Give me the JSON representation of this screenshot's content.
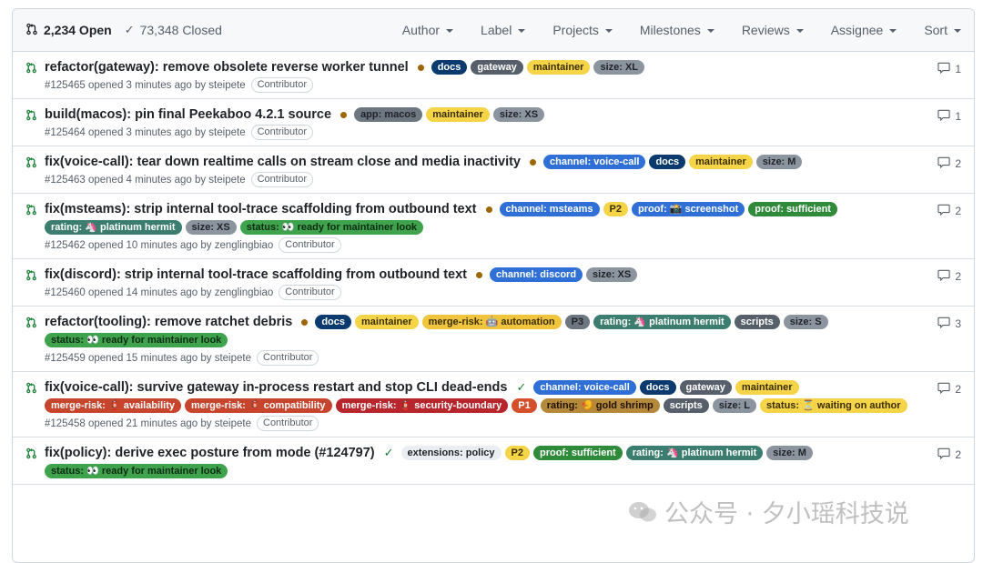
{
  "header": {
    "open_label": "2,234 Open",
    "closed_label": "73,348 Closed",
    "filters": [
      "Author",
      "Label",
      "Projects",
      "Milestones",
      "Reviews",
      "Assignee",
      "Sort"
    ]
  },
  "colors": {
    "open_green": "#1a7f37",
    "pending_dot": "#9a6700"
  },
  "rows": [
    {
      "title": "refactor(gateway): remove obsolete reverse worker tunnel",
      "status": "pending",
      "labels": [
        {
          "text": "docs",
          "bg": "#0b3a6e",
          "fg": "#ffffff"
        },
        {
          "text": "gateway",
          "bg": "#57606a",
          "fg": "#ffffff"
        },
        {
          "text": "maintainer",
          "bg": "#f5d547",
          "fg": "#3a2d00"
        },
        {
          "text": "size: XL",
          "bg": "#8c959f",
          "fg": "#1f2328"
        }
      ],
      "meta": "#125465 opened 3 minutes ago by steipete",
      "badge": "Contributor",
      "comments": "1"
    },
    {
      "title": "build(macos): pin final Peekaboo 4.2.1 source",
      "status": "pending",
      "labels": [
        {
          "text": "app: macos",
          "bg": "#6e7781",
          "fg": "#1f2328"
        },
        {
          "text": "maintainer",
          "bg": "#f5d547",
          "fg": "#3a2d00"
        },
        {
          "text": "size: XS",
          "bg": "#8c959f",
          "fg": "#1f2328"
        }
      ],
      "meta": "#125464 opened 3 minutes ago by steipete",
      "badge": "Contributor",
      "comments": "1"
    },
    {
      "title": "fix(voice-call): tear down realtime calls on stream close and media inactivity",
      "status": "pending",
      "labels": [
        {
          "text": "channel: voice-call",
          "bg": "#2f6fd6",
          "fg": "#ffffff"
        },
        {
          "text": "docs",
          "bg": "#0b3a6e",
          "fg": "#ffffff"
        },
        {
          "text": "maintainer",
          "bg": "#f5d547",
          "fg": "#3a2d00"
        },
        {
          "text": "size: M",
          "bg": "#8c959f",
          "fg": "#1f2328"
        }
      ],
      "meta": "#125463 opened 4 minutes ago by steipete",
      "badge": "Contributor",
      "comments": "2"
    },
    {
      "title": "fix(msteams): strip internal tool-trace scaffolding from outbound text",
      "status": "pending",
      "labels": [
        {
          "text": "channel: msteams",
          "bg": "#2f6fd6",
          "fg": "#ffffff"
        },
        {
          "text": "P2",
          "bg": "#f5d547",
          "fg": "#3a2d00"
        },
        {
          "text": "proof: 📸 screenshot",
          "bg": "#2f6fd6",
          "fg": "#ffffff"
        },
        {
          "text": "proof: sufficient",
          "bg": "#2f8a3a",
          "fg": "#ffffff"
        },
        {
          "text": "rating: 🦄 platinum hermit",
          "bg": "#3b7d6e",
          "fg": "#ffffff"
        },
        {
          "text": "size: XS",
          "bg": "#8c959f",
          "fg": "#1f2328"
        },
        {
          "text": "status: 👀 ready for maintainer look",
          "bg": "#3fa34d",
          "fg": "#0d2b12"
        }
      ],
      "meta": "#125462 opened 10 minutes ago by zenglingbiao",
      "badge": "Contributor",
      "comments": "2"
    },
    {
      "title": "fix(discord): strip internal tool-trace scaffolding from outbound text",
      "status": "pending",
      "labels": [
        {
          "text": "channel: discord",
          "bg": "#2f6fd6",
          "fg": "#ffffff"
        },
        {
          "text": "size: XS",
          "bg": "#8c959f",
          "fg": "#1f2328"
        }
      ],
      "meta": "#125460 opened 14 minutes ago by zenglingbiao",
      "badge": "Contributor",
      "comments": "2"
    },
    {
      "title": "refactor(tooling): remove ratchet debris",
      "status": "pending",
      "labels": [
        {
          "text": "docs",
          "bg": "#0b3a6e",
          "fg": "#ffffff"
        },
        {
          "text": "maintainer",
          "bg": "#f5d547",
          "fg": "#3a2d00"
        },
        {
          "text": "merge-risk: 🤖 automation",
          "bg": "#f0c43c",
          "fg": "#3a2d00"
        },
        {
          "text": "P3",
          "bg": "#6e7781",
          "fg": "#1f2328"
        },
        {
          "text": "rating: 🦄 platinum hermit",
          "bg": "#3b7d6e",
          "fg": "#ffffff"
        },
        {
          "text": "scripts",
          "bg": "#57606a",
          "fg": "#ffffff"
        },
        {
          "text": "size: S",
          "bg": "#8c959f",
          "fg": "#1f2328"
        },
        {
          "text": "status: 👀 ready for maintainer look",
          "bg": "#3fa34d",
          "fg": "#0d2b12"
        }
      ],
      "meta": "#125459 opened 15 minutes ago by steipete",
      "badge": "Contributor",
      "comments": "3"
    },
    {
      "title": "fix(voice-call): survive gateway in-process restart and stop CLI dead-ends",
      "status": "success",
      "labels": [
        {
          "text": "channel: voice-call",
          "bg": "#2f6fd6",
          "fg": "#ffffff"
        },
        {
          "text": "docs",
          "bg": "#0b3a6e",
          "fg": "#ffffff"
        },
        {
          "text": "gateway",
          "bg": "#57606a",
          "fg": "#ffffff"
        },
        {
          "text": "maintainer",
          "bg": "#f5d547",
          "fg": "#3a2d00"
        },
        {
          "text": "merge-risk: 🧯 availability",
          "bg": "#c8452d",
          "fg": "#ffffff"
        },
        {
          "text": "merge-risk: 🧯 compatibility",
          "bg": "#c8452d",
          "fg": "#ffffff"
        },
        {
          "text": "merge-risk: 🧯 security-boundary",
          "bg": "#b8262d",
          "fg": "#ffffff"
        },
        {
          "text": "P1",
          "bg": "#d4502d",
          "fg": "#ffffff"
        },
        {
          "text": "rating: 🍤 gold shrimp",
          "bg": "#b5893a",
          "fg": "#1f1200"
        },
        {
          "text": "scripts",
          "bg": "#57606a",
          "fg": "#ffffff"
        },
        {
          "text": "size: L",
          "bg": "#8c959f",
          "fg": "#1f2328"
        },
        {
          "text": "status: ⏳ waiting on author",
          "bg": "#f5d547",
          "fg": "#3a2d00"
        }
      ],
      "meta": "#125458 opened 21 minutes ago by steipete",
      "badge": "Contributor",
      "comments": "2"
    },
    {
      "title": "fix(policy): derive exec posture from mode (#124797)",
      "status": "success",
      "labels": [
        {
          "text": "extensions: policy",
          "bg": "#eaeef2",
          "fg": "#1f2328"
        },
        {
          "text": "P2",
          "bg": "#f5d547",
          "fg": "#3a2d00"
        },
        {
          "text": "proof: sufficient",
          "bg": "#2f8a3a",
          "fg": "#ffffff"
        },
        {
          "text": "rating: 🦄 platinum hermit",
          "bg": "#3b7d6e",
          "fg": "#ffffff"
        },
        {
          "text": "size: M",
          "bg": "#8c959f",
          "fg": "#1f2328"
        },
        {
          "text": "status: 👀 ready for maintainer look",
          "bg": "#3fa34d",
          "fg": "#0d2b12"
        }
      ],
      "meta": "",
      "badge": "",
      "comments": "2"
    }
  ],
  "watermark": {
    "text": "公众号 · 夕小瑶科技说"
  }
}
